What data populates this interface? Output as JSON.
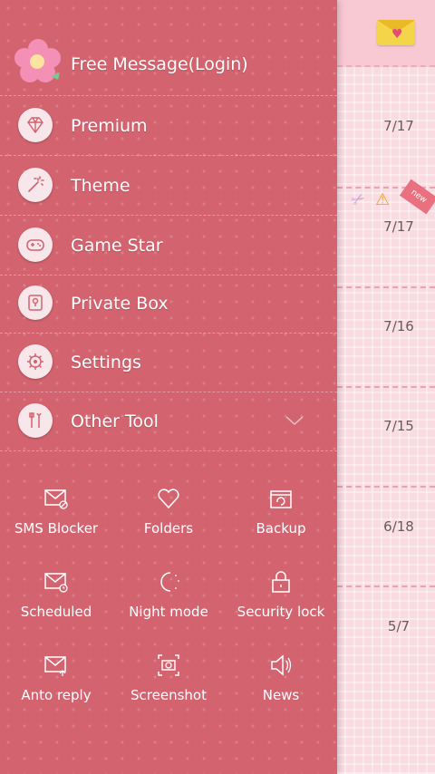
{
  "login": {
    "label": "Free Message(Login)"
  },
  "menu": [
    {
      "label": "Premium",
      "icon": "diamond-icon"
    },
    {
      "label": "Theme",
      "icon": "magic-wand-icon"
    },
    {
      "label": "Game Star",
      "icon": "gamepad-icon"
    },
    {
      "label": "Private Box",
      "icon": "keyhole-icon"
    },
    {
      "label": "Settings",
      "icon": "gear-icon"
    },
    {
      "label": "Other Tool",
      "icon": "tools-icon"
    }
  ],
  "tools": [
    {
      "label": "SMS Blocker",
      "icon": "envelope-block-icon"
    },
    {
      "label": "Folders",
      "icon": "heart-icon"
    },
    {
      "label": "Backup",
      "icon": "backup-icon"
    },
    {
      "label": "Scheduled",
      "icon": "envelope-clock-icon"
    },
    {
      "label": "Night mode",
      "icon": "moon-icon"
    },
    {
      "label": "Security lock",
      "icon": "lock-icon"
    },
    {
      "label": "Anto reply",
      "icon": "envelope-reply-icon"
    },
    {
      "label": "Screenshot",
      "icon": "camera-icon"
    },
    {
      "label": "News",
      "icon": "speaker-icon"
    }
  ],
  "conversations": [
    {
      "date": "7/17"
    },
    {
      "date": "7/17",
      "badge": "new"
    },
    {
      "date": "7/16"
    },
    {
      "date": "7/15"
    },
    {
      "date": "6/18"
    },
    {
      "date": "5/7"
    }
  ],
  "colors": {
    "drawer": "#d2636f",
    "background": "#f9dce2",
    "text": "#ffffff"
  }
}
